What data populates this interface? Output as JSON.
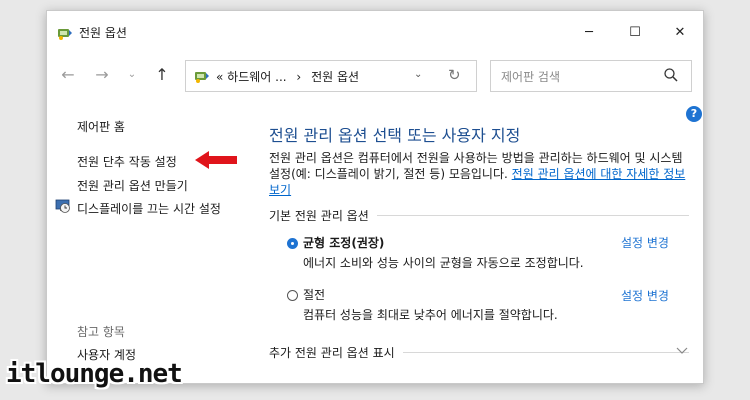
{
  "window": {
    "title": "전원 옵션",
    "controls": {
      "minimize": "─",
      "maximize": "☐",
      "close": "✕"
    }
  },
  "nav": {
    "back": "←",
    "forward": "→",
    "recent": "⌄",
    "up": "↑"
  },
  "address": {
    "prefix": "«",
    "crumb1": "하드웨어 ...",
    "separator": "›",
    "crumb2": "전원 옵션",
    "dropdown": "⌄",
    "refresh": "↻"
  },
  "search": {
    "placeholder": "제어판 검색"
  },
  "help": "?",
  "sidebar": {
    "home": "제어판 홈",
    "links": [
      {
        "label": "전원 단추 작동 설정"
      },
      {
        "label": "전원 관리 옵션 만들기"
      },
      {
        "label": "디스플레이를 끄는 시간 설정",
        "icon": "display-clock-icon"
      }
    ],
    "see_also_heading": "참고 항목",
    "see_also": [
      {
        "label": "사용자 계정"
      }
    ]
  },
  "main": {
    "title": "전원 관리 옵션 선택 또는 사용자 지정",
    "description": "전원 관리 옵션은 컴퓨터에서 전원을 사용하는 방법을 관리하는 하드웨어 및 시스템 설정(예: 디스플레이 밝기, 절전 등) 모음입니다. ",
    "description_link": "전원 관리 옵션에 대한 자세한 정보 보기",
    "basic_section": "기본 전원 관리 옵션",
    "plans": [
      {
        "name": "균형 조정(권장)",
        "description": "에너지 소비와 성능 사이의 균형을 자동으로 조정합니다.",
        "link": "설정 변경",
        "selected": true
      },
      {
        "name": "절전",
        "description": "컴퓨터 성능을 최대로 낮추어 에너지를 절약합니다.",
        "link": "설정 변경",
        "selected": false
      }
    ],
    "more_section": "추가 전원 관리 옵션 표시"
  },
  "watermark": "itlounge.net",
  "colors": {
    "accent": "#1e73d2",
    "title_blue": "#1e4f91",
    "link": "#0066cc",
    "arrow_red": "#e0141b"
  }
}
